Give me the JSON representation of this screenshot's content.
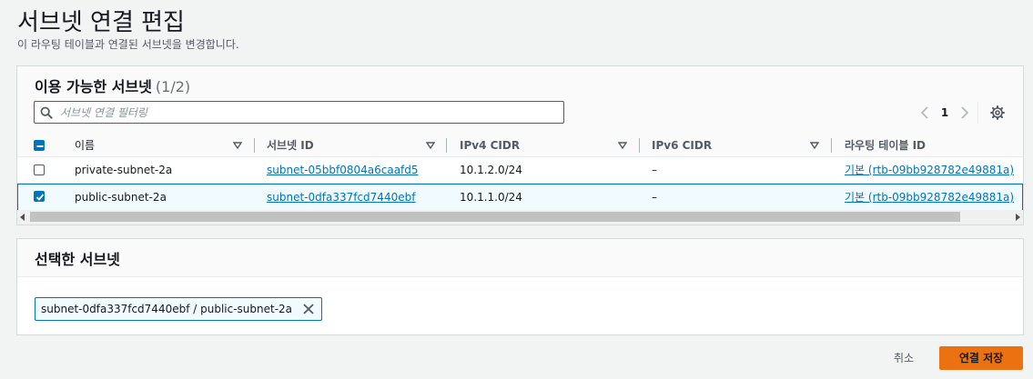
{
  "page": {
    "title": "서브넷 연결 편집",
    "description": "이 라우팅 테이블과 연결된 서브넷을 변경합니다."
  },
  "available": {
    "heading": "이용 가능한 서브넷",
    "count": "(1/2)",
    "filter_placeholder": "서브넷 연결 필터링",
    "filter_value": "",
    "page_number": "1",
    "columns": [
      "이름",
      "서브넷 ID",
      "IPv4 CIDR",
      "IPv6 CIDR",
      "라우팅 테이블 ID"
    ],
    "rows": [
      {
        "selected": false,
        "name": "private-subnet-2a",
        "subnet_id": "subnet-05bbf0804a6caafd5",
        "ipv4": "10.1.2.0/24",
        "ipv6": "–",
        "route_table": "기본 (rtb-09bb928782e49881a)"
      },
      {
        "selected": true,
        "name": "public-subnet-2a",
        "subnet_id": "subnet-0dfa337fcd7440ebf",
        "ipv4": "10.1.1.0/24",
        "ipv6": "–",
        "route_table": "기본 (rtb-09bb928782e49881a)"
      }
    ]
  },
  "selected": {
    "heading": "선택한 서브넷",
    "tokens": [
      "subnet-0dfa337fcd7440ebf / public-subnet-2a"
    ]
  },
  "footer": {
    "cancel_label": "취소",
    "save_label": "연결 저장"
  },
  "colors": {
    "primary": "#ec7211",
    "link": "#0073bb",
    "selected_row_bg": "#f1faff"
  },
  "icons": {
    "search": "search-icon",
    "settings": "gear-icon",
    "prev": "chevron-left-icon",
    "next": "chevron-right-icon",
    "sort": "caret-down-icon",
    "close": "close-icon"
  }
}
